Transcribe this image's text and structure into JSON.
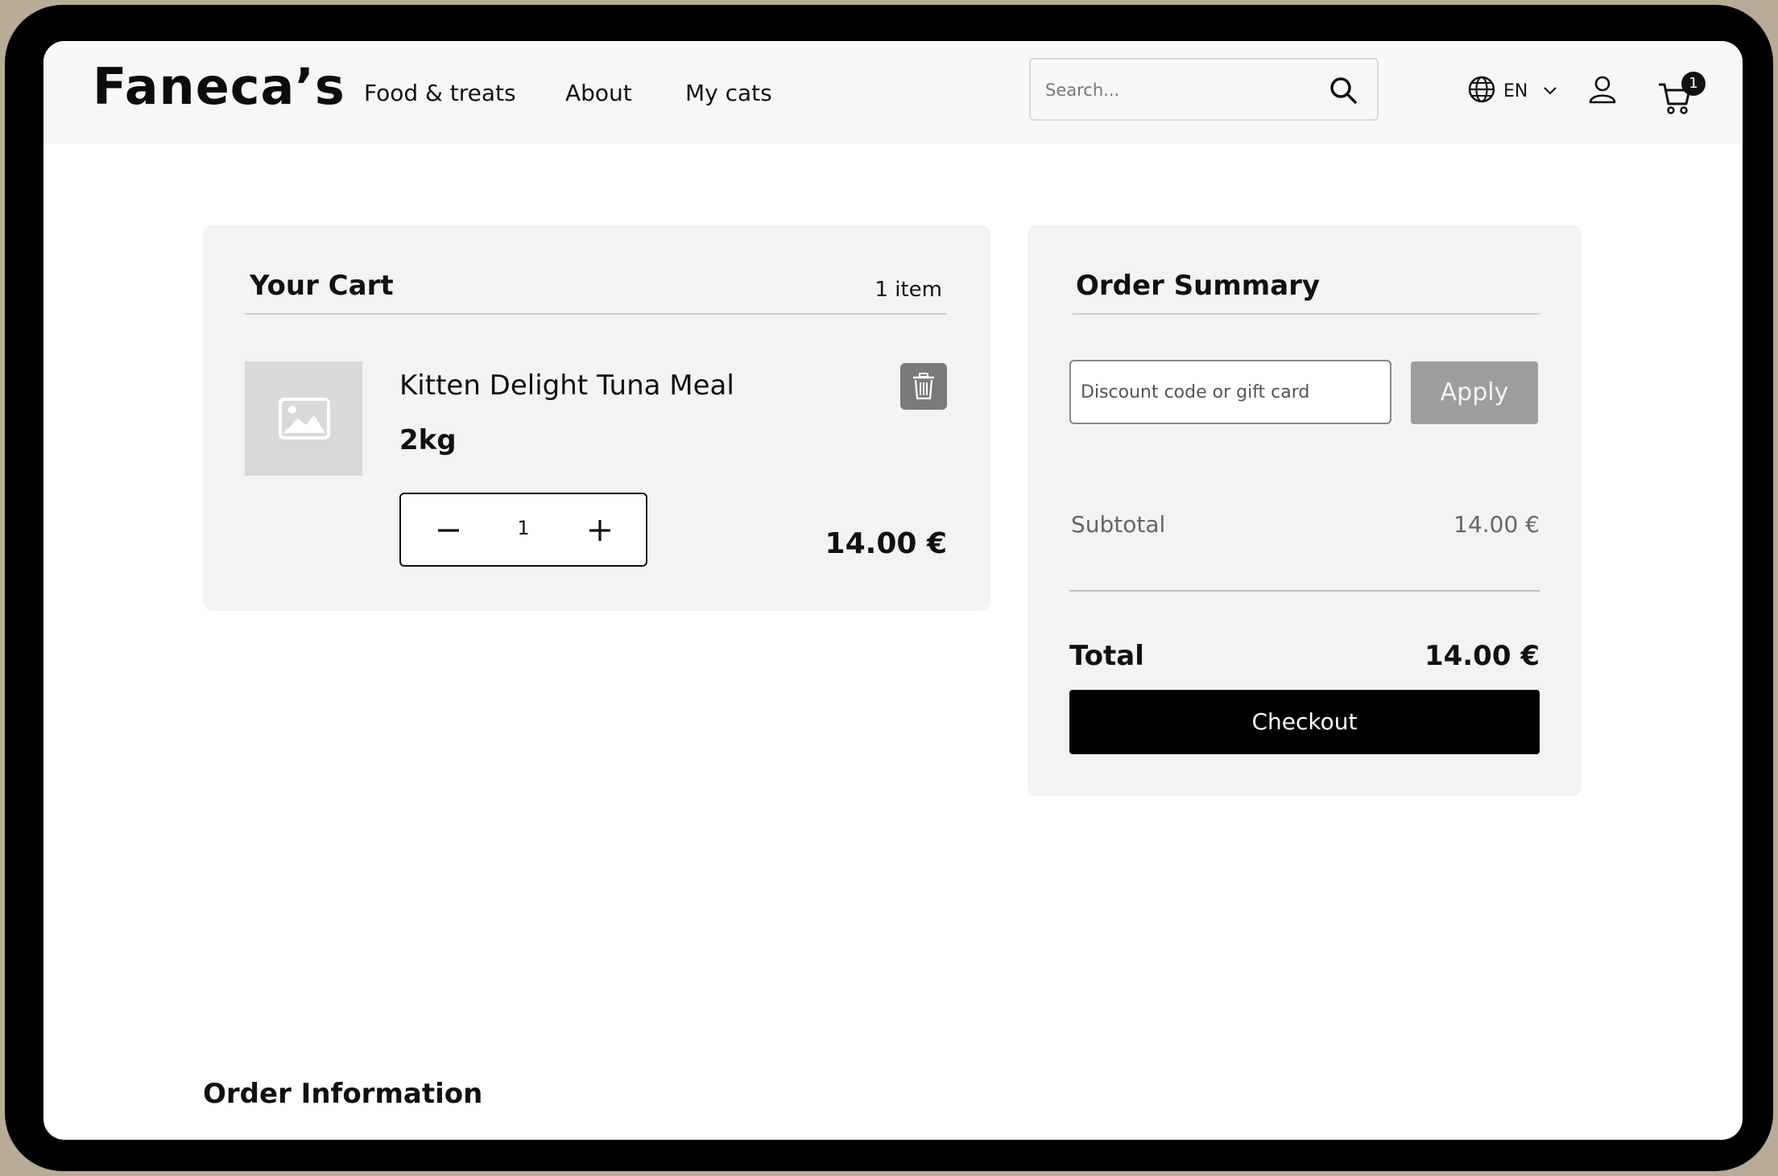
{
  "header": {
    "logo": "Faneca’s",
    "nav": [
      "Food & treats",
      "About",
      "My cats"
    ],
    "search_placeholder": "Search...",
    "language": "EN",
    "cart_count": "1"
  },
  "cart": {
    "title": "Your Cart",
    "item_count": "1 item",
    "item": {
      "name": "Kitten Delight Tuna Meal",
      "size": "2kg",
      "quantity": "1",
      "price": "14.00 €"
    }
  },
  "summary": {
    "title": "Order Summary",
    "discount_placeholder": "Discount code or gift card",
    "apply_label": "Apply",
    "subtotal_label": "Subtotal",
    "subtotal_value": "14.00 €",
    "total_label": "Total",
    "total_value": "14.00 €",
    "checkout_label": "Checkout"
  },
  "order_info": {
    "title": "Order Information"
  },
  "colors": {
    "device_frame": "#000000",
    "header_bg": "#f7f7f7",
    "panel_bg": "#f3f3f3",
    "apply_bg": "#9d9d9d",
    "checkout_bg": "#000000"
  }
}
